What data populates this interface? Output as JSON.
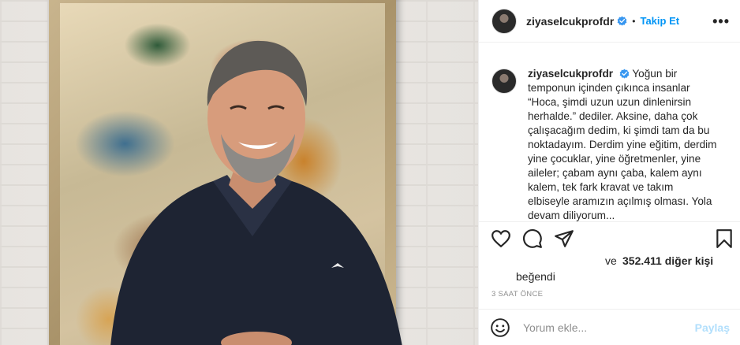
{
  "post": {
    "username": "ziyaselcukprofdr",
    "follow_label": "Takip Et",
    "dot": "•",
    "more_label": "•••",
    "caption": "Yoğun bir temponun içinden çıkınca insanlar “Hoca, şimdi uzun uzun dinlenirsin herhalde.” dediler. Aksine, daha çok çalışacağım dedim, ki şimdi tam da bu noktadayım. Derdim yine eğitim, derdim yine çocuklar, yine öğretmenler, yine aileler; çabam aynı çaba, kalem aynı kalem, tek fark kravat ve takım elbiseyle aramızın açılmış olması. Yola devam diliyorum...",
    "likes_prefix": "ve",
    "likes_count": "352.411 diğer kişi",
    "liked_label": "beğendi",
    "time_ago": "3 SAAT ÖNCE",
    "comment_placeholder": "Yorum ekle...",
    "post_button": "Paylaş"
  },
  "icons": {
    "verified": "verified-badge-icon",
    "like": "heart-icon",
    "comment": "comment-icon",
    "share": "paper-plane-icon",
    "save": "bookmark-icon",
    "emoji": "smiley-icon"
  },
  "colors": {
    "accent": "#0095f6",
    "post_disabled": "#b2dffc",
    "muted": "#8e8e8e",
    "text": "#262626",
    "border": "#efefef"
  }
}
